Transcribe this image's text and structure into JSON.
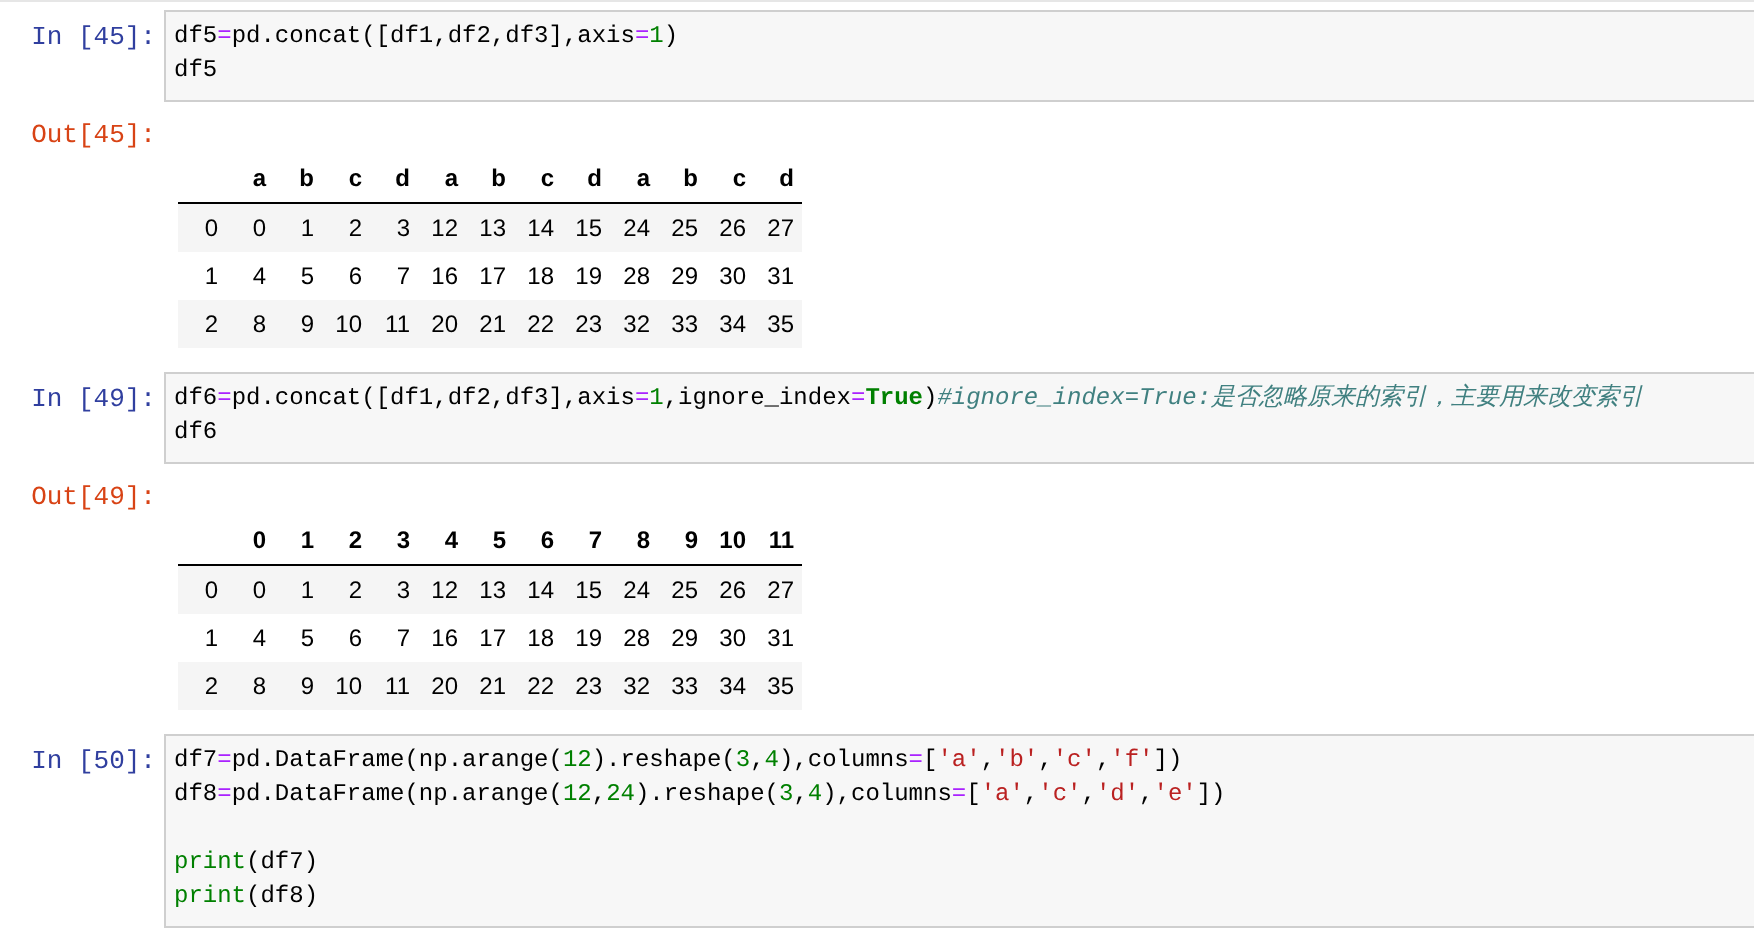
{
  "cells": [
    {
      "prompt": "In [45]:",
      "code_blocks": [
        [
          [
            {
              "kind": "plain",
              "text": "df5"
            },
            {
              "kind": "op",
              "text": "="
            },
            {
              "kind": "plain",
              "text": "pd.concat([df1,df2,df3],axis"
            },
            {
              "kind": "op",
              "text": "="
            },
            {
              "kind": "num",
              "text": "1"
            },
            {
              "kind": "plain",
              "text": ")"
            }
          ],
          [
            {
              "kind": "plain",
              "text": "df5"
            }
          ]
        ]
      ],
      "output": {
        "prompt": "Out[45]:",
        "columns": [
          "a",
          "b",
          "c",
          "d",
          "a",
          "b",
          "c",
          "d",
          "a",
          "b",
          "c",
          "d"
        ],
        "rows": [
          {
            "index": "0",
            "values": [
              "0",
              "1",
              "2",
              "3",
              "12",
              "13",
              "14",
              "15",
              "24",
              "25",
              "26",
              "27"
            ]
          },
          {
            "index": "1",
            "values": [
              "4",
              "5",
              "6",
              "7",
              "16",
              "17",
              "18",
              "19",
              "28",
              "29",
              "30",
              "31"
            ]
          },
          {
            "index": "2",
            "values": [
              "8",
              "9",
              "10",
              "11",
              "20",
              "21",
              "22",
              "23",
              "32",
              "33",
              "34",
              "35"
            ]
          }
        ]
      }
    },
    {
      "prompt": "In [49]:",
      "code_blocks": [
        [
          [
            {
              "kind": "plain",
              "text": "df6"
            },
            {
              "kind": "op",
              "text": "="
            },
            {
              "kind": "plain",
              "text": "pd.concat([df1,df2,df3],axis"
            },
            {
              "kind": "op",
              "text": "="
            },
            {
              "kind": "num",
              "text": "1"
            },
            {
              "kind": "plain",
              "text": ",ignore_index"
            },
            {
              "kind": "op",
              "text": "="
            },
            {
              "kind": "kw",
              "text": "True"
            },
            {
              "kind": "plain",
              "text": ")"
            },
            {
              "kind": "comment",
              "text": "#ignore_index=True:是否忽略原来的索引，主要用来改变索引"
            }
          ],
          [
            {
              "kind": "plain",
              "text": "df6"
            }
          ]
        ]
      ],
      "output": {
        "prompt": "Out[49]:",
        "columns": [
          "0",
          "1",
          "2",
          "3",
          "4",
          "5",
          "6",
          "7",
          "8",
          "9",
          "10",
          "11"
        ],
        "rows": [
          {
            "index": "0",
            "values": [
              "0",
              "1",
              "2",
              "3",
              "12",
              "13",
              "14",
              "15",
              "24",
              "25",
              "26",
              "27"
            ]
          },
          {
            "index": "1",
            "values": [
              "4",
              "5",
              "6",
              "7",
              "16",
              "17",
              "18",
              "19",
              "28",
              "29",
              "30",
              "31"
            ]
          },
          {
            "index": "2",
            "values": [
              "8",
              "9",
              "10",
              "11",
              "20",
              "21",
              "22",
              "23",
              "32",
              "33",
              "34",
              "35"
            ]
          }
        ]
      }
    },
    {
      "prompt": "In [50]:",
      "code_blocks": [
        [
          [
            {
              "kind": "plain",
              "text": "df7"
            },
            {
              "kind": "op",
              "text": "="
            },
            {
              "kind": "plain",
              "text": "pd.DataFrame(np.arange("
            },
            {
              "kind": "num",
              "text": "12"
            },
            {
              "kind": "plain",
              "text": ").reshape("
            },
            {
              "kind": "num",
              "text": "3"
            },
            {
              "kind": "plain",
              "text": ","
            },
            {
              "kind": "num",
              "text": "4"
            },
            {
              "kind": "plain",
              "text": "),columns"
            },
            {
              "kind": "op",
              "text": "="
            },
            {
              "kind": "plain",
              "text": "["
            },
            {
              "kind": "str",
              "text": "'a'"
            },
            {
              "kind": "plain",
              "text": ","
            },
            {
              "kind": "str",
              "text": "'b'"
            },
            {
              "kind": "plain",
              "text": ","
            },
            {
              "kind": "str",
              "text": "'c'"
            },
            {
              "kind": "plain",
              "text": ","
            },
            {
              "kind": "str",
              "text": "'f'"
            },
            {
              "kind": "plain",
              "text": "])"
            }
          ],
          [
            {
              "kind": "plain",
              "text": "df8"
            },
            {
              "kind": "op",
              "text": "="
            },
            {
              "kind": "plain",
              "text": "pd.DataFrame(np.arange("
            },
            {
              "kind": "num",
              "text": "12"
            },
            {
              "kind": "plain",
              "text": ","
            },
            {
              "kind": "num",
              "text": "24"
            },
            {
              "kind": "plain",
              "text": ").reshape("
            },
            {
              "kind": "num",
              "text": "3"
            },
            {
              "kind": "plain",
              "text": ","
            },
            {
              "kind": "num",
              "text": "4"
            },
            {
              "kind": "plain",
              "text": "),columns"
            },
            {
              "kind": "op",
              "text": "="
            },
            {
              "kind": "plain",
              "text": "["
            },
            {
              "kind": "str",
              "text": "'a'"
            },
            {
              "kind": "plain",
              "text": ","
            },
            {
              "kind": "str",
              "text": "'c'"
            },
            {
              "kind": "plain",
              "text": ","
            },
            {
              "kind": "str",
              "text": "'d'"
            },
            {
              "kind": "plain",
              "text": ","
            },
            {
              "kind": "str",
              "text": "'e'"
            },
            {
              "kind": "plain",
              "text": "])"
            }
          ]
        ],
        [
          [
            {
              "kind": "builtin",
              "text": "print"
            },
            {
              "kind": "plain",
              "text": "(df7)"
            }
          ],
          [
            {
              "kind": "builtin",
              "text": "print"
            },
            {
              "kind": "plain",
              "text": "(df8)"
            }
          ]
        ]
      ]
    }
  ]
}
